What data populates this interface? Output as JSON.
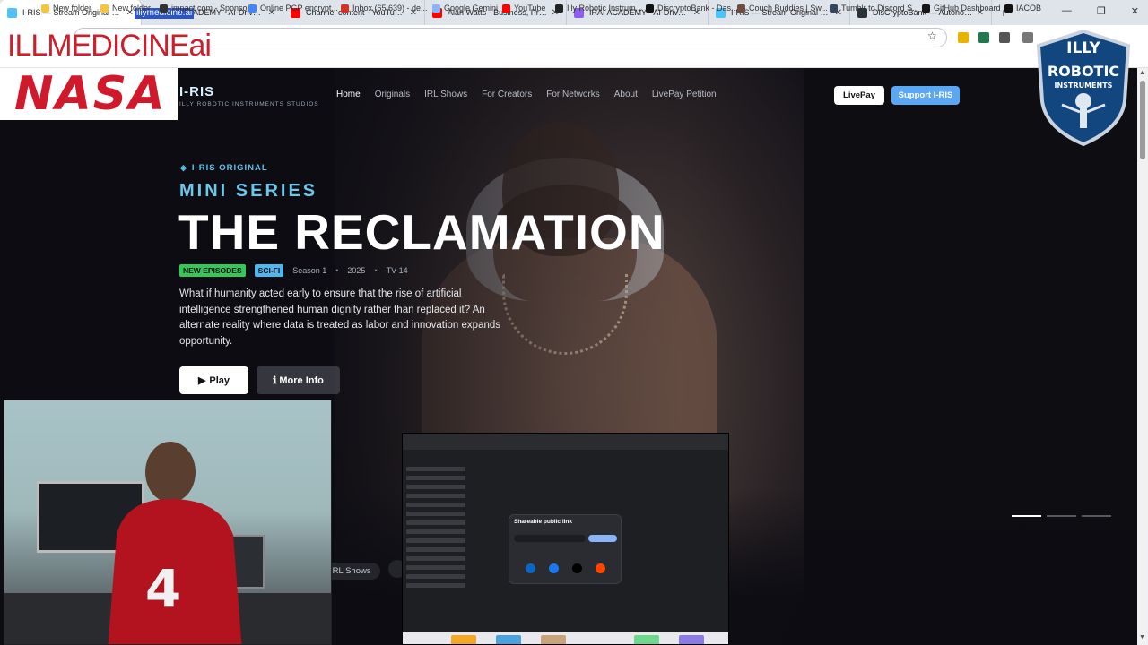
{
  "browser": {
    "tabs": [
      {
        "title": "I-RIS — Stream Original Series",
        "favicon_color": "#4fc3f7",
        "active": true
      },
      {
        "title": "IRAI ACADEMY - AI-Driven Dev",
        "favicon_color": "#8e5cf0",
        "active": false
      },
      {
        "title": "Channel content - YouTube Stu",
        "favicon_color": "#ff0000",
        "active": false
      },
      {
        "title": "Alan Watts - Business, Propaga",
        "favicon_color": "#ff0000",
        "active": false
      },
      {
        "title": "IRAI ACADEMY - AI-Driven Dev",
        "favicon_color": "#8e5cf0",
        "active": false
      },
      {
        "title": "I-RIS — Stream Original Series",
        "favicon_color": "#4fc3f7",
        "active": false
      },
      {
        "title": "DisCryptoBank — Autonomous",
        "favicon_color": "#263238",
        "active": false
      }
    ],
    "new_tab": "+",
    "window_controls": [
      "—",
      "❐",
      "✕"
    ],
    "address_bar": {
      "url": "illymedicine.ai"
    },
    "bookmarks": [
      {
        "label": "New folder",
        "icon_color": "#f5c542"
      },
      {
        "label": "New folder",
        "icon_color": "#f5c542"
      },
      {
        "label": "impact.com - Sponso",
        "icon_color": "#333333"
      },
      {
        "label": "Online PGP encrypt...",
        "icon_color": "#4285f4"
      },
      {
        "label": "Inbox (65,639) - de...",
        "icon_color": "#d93025"
      },
      {
        "label": "Google Gemini",
        "icon_color": "#8ab4f8"
      },
      {
        "label": "YouTube",
        "icon_color": "#ff0000"
      },
      {
        "label": "Illy Robotic Instrum...",
        "icon_color": "#222222"
      },
      {
        "label": "DiscryptoBank - Das...",
        "icon_color": "#111111"
      },
      {
        "label": "Couch Buddies | Sw...",
        "icon_color": "#6d4c41"
      },
      {
        "label": "Tumblr to Discord S...",
        "icon_color": "#35465c"
      },
      {
        "label": "GitHub Dashboard",
        "icon_color": "#181717"
      },
      {
        "label": "IACOB",
        "icon_color": "#111111"
      }
    ]
  },
  "site": {
    "logo": "I-RIS",
    "logo_sub": "ILLY ROBOTIC INSTRUMENTS STUDIOS",
    "nav": [
      "Home",
      "Originals",
      "IRL Shows",
      "For Creators",
      "For Networks",
      "About",
      "LivePay Petition"
    ],
    "nav_active": "Home",
    "livepay_label": "LivePay",
    "support_label": "Support I-RIS"
  },
  "hero": {
    "eyebrow": "I-RIS ORIGINAL",
    "kicker": "MINI SERIES",
    "title": "THE RECLAMATION",
    "badges": {
      "new": "NEW EPISODES",
      "genre": "SCI-FI"
    },
    "season": "Season 1",
    "year": "2025",
    "rating": "TV-14",
    "separator": "•",
    "description": "What if humanity acted early to ensure that the rise of artificial intelligence strengthened human dignity rather than replaced it? An alternate reality where data is treated as labor and innovation expands opportunity.",
    "play_label": "Play",
    "more_info_label": "More Info"
  },
  "row_label": "IRL Shows",
  "overlays": {
    "watermark_text": "ILLMEDICINEai",
    "nasa_logo_text": "NASA",
    "badge_logo_lines": [
      "ILLY",
      "ROBOTIC",
      "INSTRUMENTS"
    ],
    "jersey_number": "4",
    "share_modal_title": "Shareable public link"
  },
  "colors": {
    "accent_cyan": "#6cc7e9",
    "support_blue": "#5aa8f5",
    "new_green": "#34c759",
    "nasa_red": "#d0192b"
  }
}
